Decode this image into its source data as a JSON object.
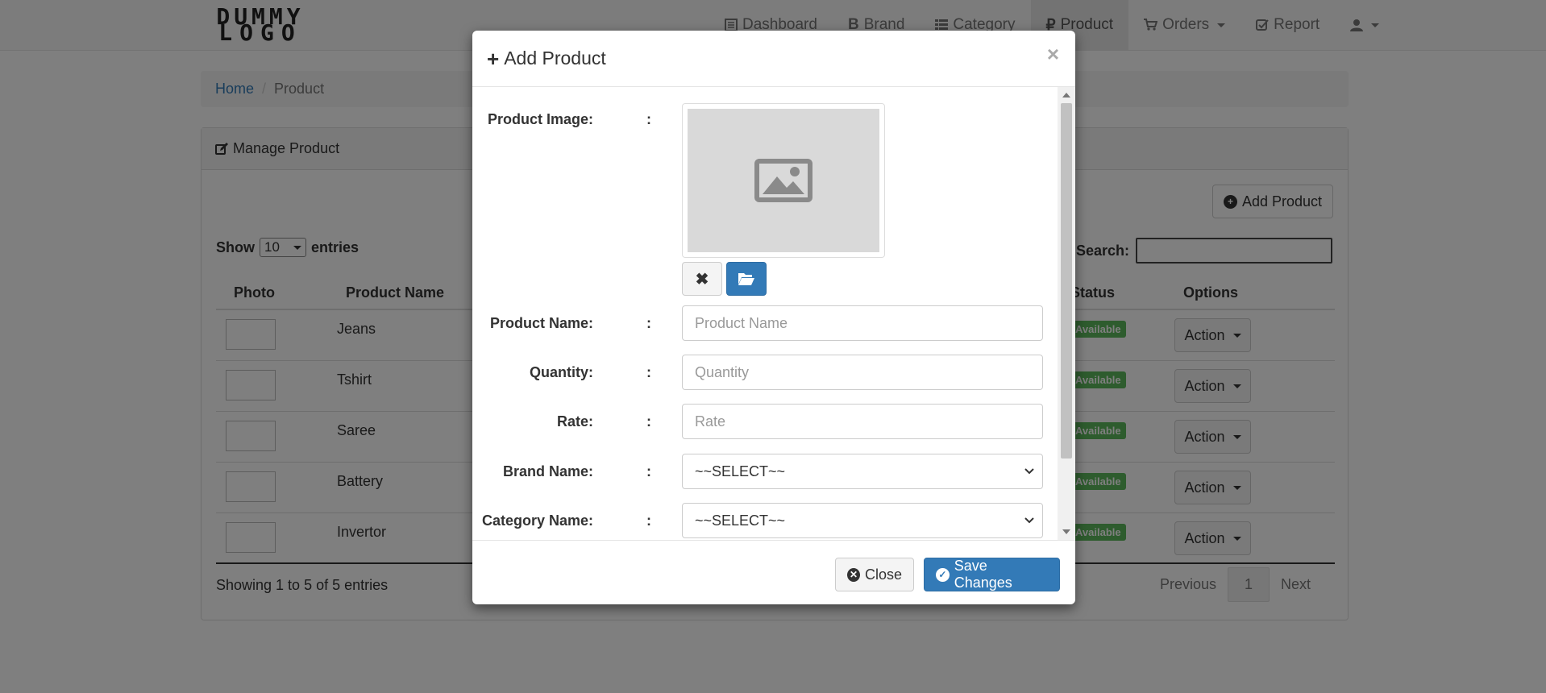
{
  "navbar": {
    "logo_line1": "DUMMY",
    "logo_line2": "LOGO",
    "items": [
      {
        "label": "Dashboard",
        "icon": "list-alt-icon"
      },
      {
        "label": "Brand",
        "icon": "bitcoin-icon"
      },
      {
        "label": "Category",
        "icon": "th-list-icon"
      },
      {
        "label": "Product",
        "icon": "ruble-icon",
        "active": true
      },
      {
        "label": "Orders",
        "icon": "shopping-cart-icon",
        "dropdown": true
      },
      {
        "label": "Report",
        "icon": "check-square-icon"
      },
      {
        "label": "",
        "icon": "user-icon",
        "dropdown": true
      }
    ]
  },
  "breadcrumb": {
    "home": "Home",
    "separator": "/",
    "current": "Product"
  },
  "panel": {
    "title": "Manage Product",
    "add_button": "Add Product",
    "show_label": "Show",
    "entries_label": "entries",
    "entries_value": "10",
    "search_label": "Search:",
    "columns": {
      "photo": "Photo",
      "name": "Product Name",
      "status": "Status",
      "options": "Options"
    },
    "rows": [
      {
        "name": "Jeans",
        "status": "Available",
        "action": "Action"
      },
      {
        "name": "Tshirt",
        "status": "Available",
        "action": "Action"
      },
      {
        "name": "Saree",
        "status": "Available",
        "action": "Action"
      },
      {
        "name": "Battery",
        "status": "Available",
        "action": "Action"
      },
      {
        "name": "Invertor",
        "status": "Available",
        "action": "Action"
      }
    ],
    "footer_text": "Showing 1 to 5 of 5 entries",
    "pagination": {
      "previous": "Previous",
      "current_page": "1",
      "next": "Next"
    }
  },
  "modal": {
    "title": "Add Product",
    "close_symbol": "×",
    "colon": ":",
    "fields": {
      "image_label": "Product Image:",
      "name_label": "Product Name:",
      "name_placeholder": "Product Name",
      "quantity_label": "Quantity:",
      "quantity_placeholder": "Quantity",
      "rate_label": "Rate:",
      "rate_placeholder": "Rate",
      "brand_label": "Brand Name:",
      "brand_value": "~~SELECT~~",
      "category_label": "Category Name:",
      "category_value": "~~SELECT~~"
    },
    "close_button": "Close",
    "save_button": "Save Changes"
  },
  "colors": {
    "primary": "#337ab7",
    "success": "#5cb85c",
    "overlay": "rgba(0,0,0,0.5)"
  }
}
